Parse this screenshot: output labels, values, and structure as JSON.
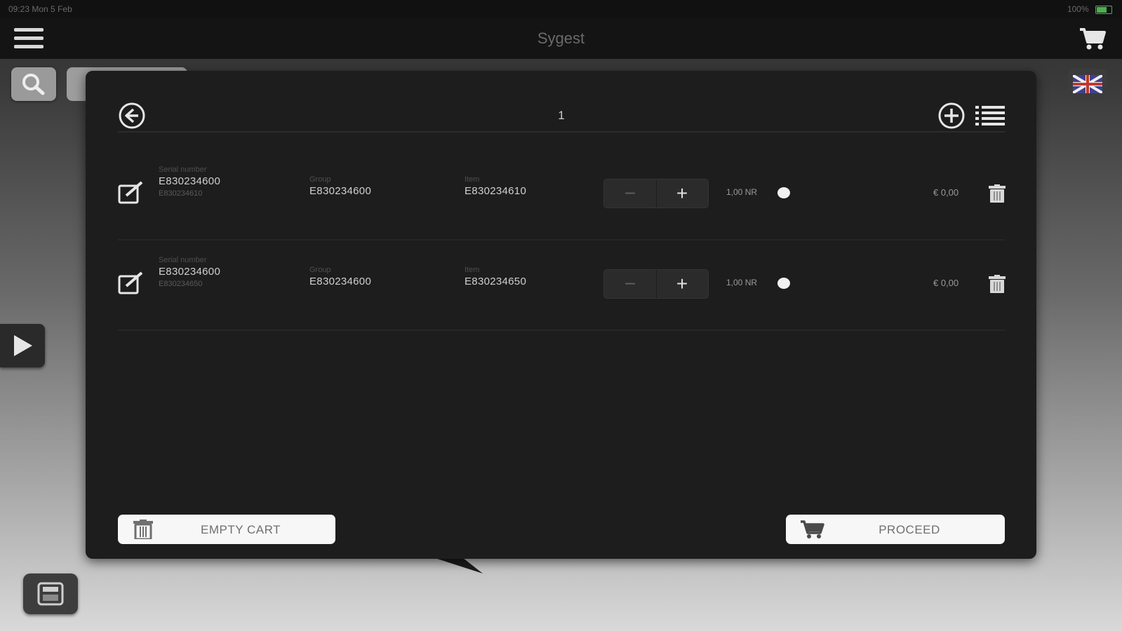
{
  "status_bar": {
    "time": "09:23",
    "date": "Mon 5 Feb",
    "battery": "100%"
  },
  "header": {
    "title": "Sygest"
  },
  "popover": {
    "page_number": "1",
    "rows": [
      {
        "serial_label": "Serial number",
        "serial_value": "E830234600",
        "serial_sub": "E830234610",
        "group_label": "Group",
        "group_value": "E830234600",
        "item_label": "Item",
        "item_value": "E830234610",
        "quantity": "1,00 NR",
        "price": "€ 0,00"
      },
      {
        "serial_label": "Serial number",
        "serial_value": "E830234600",
        "serial_sub": "E830234650",
        "group_label": "Group",
        "group_value": "E830234600",
        "item_label": "Item",
        "item_value": "E830234650",
        "quantity": "1,00 NR",
        "price": "€ 0,00"
      }
    ],
    "empty_cart_label": "EMPTY CART",
    "proceed_label": "PROCEED"
  },
  "colors": {
    "popover_bg": "#1d1d1d",
    "topbar_bg": "#141414",
    "button_bg": "#f7f7f7"
  },
  "icons": [
    "menu-icon",
    "cart-icon",
    "search-icon",
    "uk-flag-icon",
    "play-icon",
    "calculator-icon",
    "back-icon",
    "add-icon",
    "list-icon",
    "edit-icon",
    "trash-icon"
  ]
}
